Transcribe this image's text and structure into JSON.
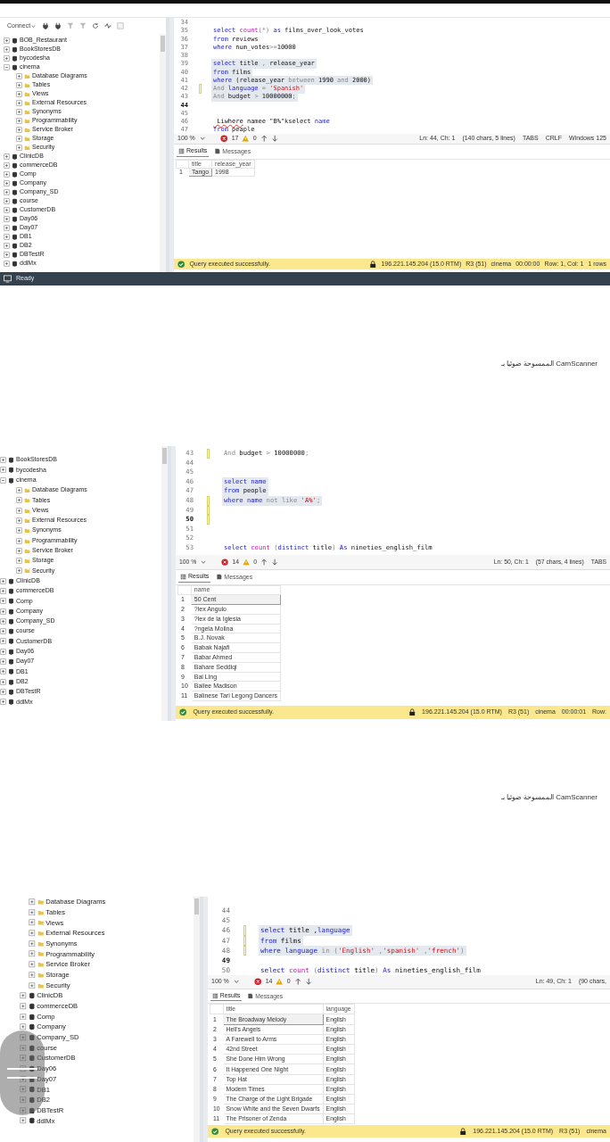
{
  "pages": [
    {
      "explorer": {
        "toolbar": {
          "connect_label": "Connect"
        },
        "items": [
          {
            "label": "BOB_Restaurant",
            "kind": "database",
            "expanded": false
          },
          {
            "label": "BookStoresDB",
            "kind": "database",
            "expanded": false
          },
          {
            "label": "bycodesha",
            "kind": "database",
            "expanded": false
          },
          {
            "label": "cinema",
            "kind": "database",
            "expanded": true,
            "children": [
              {
                "label": "Database Diagrams",
                "kind": "folder",
                "expanded": false
              },
              {
                "label": "Tables",
                "kind": "folder",
                "expanded": false
              },
              {
                "label": "Views",
                "kind": "folder",
                "expanded": false
              },
              {
                "label": "External Resources",
                "kind": "folder",
                "expanded": false
              },
              {
                "label": "Synonyms",
                "kind": "folder",
                "expanded": false
              },
              {
                "label": "Programmability",
                "kind": "folder",
                "expanded": false
              },
              {
                "label": "Service Broker",
                "kind": "folder",
                "expanded": false
              },
              {
                "label": "Storage",
                "kind": "folder",
                "expanded": false
              },
              {
                "label": "Security",
                "kind": "folder",
                "expanded": false
              }
            ]
          },
          {
            "label": "ClinicDB",
            "kind": "database",
            "expanded": false
          },
          {
            "label": "commerceDB",
            "kind": "database",
            "expanded": false
          },
          {
            "label": "Comp",
            "kind": "database",
            "expanded": false
          },
          {
            "label": "Company",
            "kind": "database",
            "expanded": false
          },
          {
            "label": "Company_SD",
            "kind": "database",
            "expanded": false
          },
          {
            "label": "course",
            "kind": "database",
            "expanded": false
          },
          {
            "label": "CustomerDB",
            "kind": "database",
            "expanded": false
          },
          {
            "label": "Day06",
            "kind": "database",
            "expanded": false
          },
          {
            "label": "Day07",
            "kind": "database",
            "expanded": false
          },
          {
            "label": "DB1",
            "kind": "database",
            "expanded": false
          },
          {
            "label": "DB2",
            "kind": "database",
            "expanded": false
          },
          {
            "label": "DBTestR",
            "kind": "database",
            "expanded": false
          },
          {
            "label": "ddlMx",
            "kind": "database",
            "expanded": false
          }
        ]
      },
      "editor": {
        "lines": [
          {
            "number": "34",
            "modified": false,
            "highlighted": false,
            "current": false
          },
          {
            "number": "35",
            "modified": false,
            "highlighted": false,
            "current": false,
            "tokens": [
              {
                "text": "select ",
                "kind": "keyword"
              },
              {
                "text": "count",
                "kind": "function"
              },
              {
                "text": "(*) ",
                "kind": "operator"
              },
              {
                "text": "as",
                "kind": "keyword"
              },
              {
                "text": " films_over_look_votes",
                "kind": "plain"
              }
            ]
          },
          {
            "number": "36",
            "modified": false,
            "highlighted": false,
            "current": false,
            "tokens": [
              {
                "text": "from",
                "kind": "keyword"
              },
              {
                "text": " reviews",
                "kind": "plain"
              }
            ]
          },
          {
            "number": "37",
            "modified": false,
            "highlighted": false,
            "current": false,
            "tokens": [
              {
                "text": "where",
                "kind": "keyword"
              },
              {
                "text": " num_votes",
                "kind": "plain"
              },
              {
                "text": ">=",
                "kind": "operator"
              },
              {
                "text": "10000",
                "kind": "plain"
              }
            ]
          },
          {
            "number": "38",
            "modified": false,
            "highlighted": false,
            "current": false
          },
          {
            "number": "39",
            "modified": false,
            "highlighted": true,
            "current": false,
            "tokens": [
              {
                "text": "select",
                "kind": "keyword"
              },
              {
                "text": " title ",
                "kind": "plain"
              },
              {
                "text": ",",
                "kind": "operator"
              },
              {
                "text": " release_year",
                "kind": "plain"
              }
            ]
          },
          {
            "number": "40",
            "modified": false,
            "highlighted": true,
            "current": false,
            "tokens": [
              {
                "text": "from",
                "kind": "keyword"
              },
              {
                "text": " films",
                "kind": "plain"
              }
            ]
          },
          {
            "number": "41",
            "modified": false,
            "highlighted": true,
            "current": false,
            "tokens": [
              {
                "text": "where",
                "kind": "keyword"
              },
              {
                "text": " (release_year ",
                "kind": "plain"
              },
              {
                "text": "between",
                "kind": "operator"
              },
              {
                "text": " 1990 ",
                "kind": "plain"
              },
              {
                "text": "and",
                "kind": "operator"
              },
              {
                "text": " 2000)",
                "kind": "plain"
              }
            ]
          },
          {
            "number": "42",
            "modified": true,
            "highlighted": true,
            "current": false,
            "tokens": [
              {
                "text": "And ",
                "kind": "operator"
              },
              {
                "text": "language",
                "kind": "keyword"
              },
              {
                "text": " = ",
                "kind": "operator"
              },
              {
                "text": "'Spanish'",
                "kind": "string"
              }
            ]
          },
          {
            "number": "43",
            "modified": false,
            "highlighted": true,
            "current": false,
            "tokens": [
              {
                "text": "And",
                "kind": "operator"
              },
              {
                "text": " budget ",
                "kind": "plain"
              },
              {
                "text": ">",
                "kind": "operator"
              },
              {
                "text": " 10000000",
                "kind": "plain"
              },
              {
                "text": ";",
                "kind": "operator"
              }
            ]
          },
          {
            "number": "44",
            "modified": false,
            "highlighted": false,
            "current": true
          },
          {
            "number": "45",
            "modified": false,
            "highlighted": false,
            "current": false
          },
          {
            "number": "46",
            "modified": false,
            "highlighted": false,
            "current": false,
            "tokens": [
              {
                "text": " Liwhere",
                "kind": "error"
              },
              {
                "text": " namee \"B%\"kselect ",
                "kind": "plain"
              },
              {
                "text": "name",
                "kind": "keyword"
              }
            ]
          },
          {
            "number": "47",
            "modified": false,
            "highlighted": false,
            "current": false,
            "tokens": [
              {
                "text": "from",
                "kind": "keyword"
              },
              {
                "text": " peaple",
                "kind": "plain"
              }
            ]
          }
        ],
        "toolbar": {
          "zoom": "100 %",
          "errors": "17",
          "warnings": "0",
          "info": [
            "Ln: 44, Ch: 1",
            "(140 chars, 5 lines)",
            "TABS",
            "CRLF",
            "Windows 125"
          ]
        }
      },
      "results": {
        "tabs": [
          {
            "label": "Results",
            "selected": true
          },
          {
            "label": "Messages",
            "selected": false
          }
        ],
        "columns": [
          "title",
          "release_year"
        ],
        "rows": [
          {
            "number": "1",
            "selected": true,
            "cells": [
              "Tango",
              "1998"
            ]
          }
        ]
      },
      "status_bar": {
        "message": "Query executed successfully.",
        "fields": [
          "196.221.145.204 (15.0 RTM)",
          "R3 (51)",
          "cinema",
          "00:00:00",
          "Row: 1, Col: 1",
          "1 rows"
        ]
      },
      "taskbar": {
        "status": "Ready"
      },
      "footer": "الممسوحة ضوئيا بـ CamScanner"
    },
    {
      "explorer": {
        "items": [
          {
            "label": "BookStoresDB",
            "kind": "database",
            "expanded": false
          },
          {
            "label": "bycodesha",
            "kind": "database",
            "expanded": false
          },
          {
            "label": "cinema",
            "kind": "database",
            "expanded": true,
            "children": [
              {
                "label": "Database Diagrams",
                "kind": "folder",
                "expanded": false
              },
              {
                "label": "Tables",
                "kind": "folder",
                "expanded": false
              },
              {
                "label": "Views",
                "kind": "folder",
                "expanded": false
              },
              {
                "label": "External Resources",
                "kind": "folder",
                "expanded": false
              },
              {
                "label": "Synonyms",
                "kind": "folder",
                "expanded": false
              },
              {
                "label": "Programmability",
                "kind": "folder",
                "expanded": false
              },
              {
                "label": "Service Broker",
                "kind": "folder",
                "expanded": false
              },
              {
                "label": "Storage",
                "kind": "folder",
                "expanded": false
              },
              {
                "label": "Security",
                "kind": "folder",
                "expanded": false
              }
            ]
          },
          {
            "label": "ClinicDB",
            "kind": "database",
            "expanded": false
          },
          {
            "label": "commerceDB",
            "kind": "database",
            "expanded": false
          },
          {
            "label": "Comp",
            "kind": "database",
            "expanded": false
          },
          {
            "label": "Company",
            "kind": "database",
            "expanded": false
          },
          {
            "label": "Company_SD",
            "kind": "database",
            "expanded": false
          },
          {
            "label": "course",
            "kind": "database",
            "expanded": false
          },
          {
            "label": "CustomerDB",
            "kind": "database",
            "expanded": false
          },
          {
            "label": "Day06",
            "kind": "database",
            "expanded": false
          },
          {
            "label": "Day07",
            "kind": "database",
            "expanded": false
          },
          {
            "label": "DB1",
            "kind": "database",
            "expanded": false
          },
          {
            "label": "DB2",
            "kind": "database",
            "expanded": false
          },
          {
            "label": "DBTestR",
            "kind": "database",
            "expanded": false
          },
          {
            "label": "ddlMx",
            "kind": "database",
            "expanded": false
          }
        ]
      },
      "editor": {
        "lines": [
          {
            "number": "43",
            "modified": true,
            "highlighted": false,
            "current": false,
            "tokens": [
              {
                "text": "And",
                "kind": "operator"
              },
              {
                "text": " budget ",
                "kind": "plain"
              },
              {
                "text": ">",
                "kind": "operator"
              },
              {
                "text": " 10000000",
                "kind": "plain"
              },
              {
                "text": ";",
                "kind": "operator"
              }
            ]
          },
          {
            "number": "44",
            "modified": false,
            "highlighted": false,
            "current": false
          },
          {
            "number": "45",
            "modified": false,
            "highlighted": false,
            "current": false
          },
          {
            "number": "46",
            "modified": false,
            "highlighted": true,
            "current": false,
            "tokens": [
              {
                "text": "select name",
                "kind": "keyword"
              }
            ]
          },
          {
            "number": "47",
            "modified": false,
            "highlighted": true,
            "current": false,
            "tokens": [
              {
                "text": "from",
                "kind": "keyword"
              },
              {
                "text": " people",
                "kind": "plain"
              }
            ]
          },
          {
            "number": "48",
            "modified": true,
            "highlighted": true,
            "current": false,
            "tokens": [
              {
                "text": "where name",
                "kind": "keyword"
              },
              {
                "text": " not like ",
                "kind": "operator"
              },
              {
                "text": "'A%'",
                "kind": "string"
              },
              {
                "text": ";",
                "kind": "operator"
              }
            ]
          },
          {
            "number": "49",
            "modified": true,
            "highlighted": false,
            "current": false
          },
          {
            "number": "50",
            "modified": true,
            "highlighted": false,
            "current": true
          },
          {
            "number": "51",
            "modified": false,
            "highlighted": false,
            "current": false
          },
          {
            "number": "52",
            "modified": false,
            "highlighted": false,
            "current": false
          },
          {
            "number": "53",
            "modified": false,
            "highlighted": false,
            "current": false,
            "tokens": [
              {
                "text": "select ",
                "kind": "keyword"
              },
              {
                "text": "count",
                "kind": "function"
              },
              {
                "text": " (",
                "kind": "operator"
              },
              {
                "text": "distinct",
                "kind": "keyword"
              },
              {
                "text": " title",
                "kind": "plain"
              },
              {
                "text": ") ",
                "kind": "operator"
              },
              {
                "text": "As",
                "kind": "keyword"
              },
              {
                "text": " nineties_english_film",
                "kind": "plain"
              }
            ]
          }
        ],
        "toolbar": {
          "zoom": "100 %",
          "errors": "14",
          "warnings": "0",
          "info": [
            "Ln: 50, Ch: 1",
            "(57 chars, 4 lines)",
            "TABS"
          ]
        }
      },
      "results": {
        "tabs": [
          {
            "label": "Results",
            "selected": true
          },
          {
            "label": "Messages",
            "selected": false
          }
        ],
        "columns": [
          "name"
        ],
        "rows": [
          {
            "number": "1",
            "selected": true,
            "cells": [
              "50 Cent"
            ]
          },
          {
            "number": "2",
            "selected": false,
            "cells": [
              "?lex Angulo"
            ]
          },
          {
            "number": "3",
            "selected": false,
            "cells": [
              "?lex de la Iglesia"
            ]
          },
          {
            "number": "4",
            "selected": false,
            "cells": [
              "?ngela Molina"
            ]
          },
          {
            "number": "5",
            "selected": false,
            "cells": [
              "B.J. Novak"
            ]
          },
          {
            "number": "6",
            "selected": false,
            "cells": [
              "Babak Najafi"
            ]
          },
          {
            "number": "7",
            "selected": false,
            "cells": [
              "Babar Ahmed"
            ]
          },
          {
            "number": "8",
            "selected": false,
            "cells": [
              "Bahare Seddiqi"
            ]
          },
          {
            "number": "9",
            "selected": false,
            "cells": [
              "Bai Ling"
            ]
          },
          {
            "number": "10",
            "selected": false,
            "cells": [
              "Bailee Madison"
            ]
          },
          {
            "number": "11",
            "selected": false,
            "cells": [
              "Balinese Tari Legong Dancers"
            ]
          }
        ]
      },
      "status_bar": {
        "message": "Query executed successfully.",
        "fields": [
          "196.221.145.204 (15.0 RTM)",
          "R3 (51)",
          "cinema",
          "00:00:01",
          "Row:"
        ]
      },
      "footer": "الممسوحة ضوئيا بـ CamScanner"
    },
    {
      "explorer": {
        "items": [
          {
            "label": "Database Diagrams",
            "kind": "folder",
            "expanded": false
          },
          {
            "label": "Tables",
            "kind": "folder",
            "expanded": false
          },
          {
            "label": "Views",
            "kind": "folder",
            "expanded": false
          },
          {
            "label": "External Resources",
            "kind": "folder",
            "expanded": false
          },
          {
            "label": "Synonyms",
            "kind": "folder",
            "expanded": false
          },
          {
            "label": "Programmability",
            "kind": "folder",
            "expanded": false
          },
          {
            "label": "Service Broker",
            "kind": "folder",
            "expanded": false
          },
          {
            "label": "Storage",
            "kind": "folder",
            "expanded": false
          },
          {
            "label": "Security",
            "kind": "folder",
            "expanded": false
          },
          {
            "label": "ClinicDB",
            "kind": "database",
            "expanded": false
          },
          {
            "label": "commerceDB",
            "kind": "database",
            "expanded": false
          },
          {
            "label": "Comp",
            "kind": "database",
            "expanded": false
          },
          {
            "label": "Company",
            "kind": "database",
            "expanded": false
          },
          {
            "label": "Company_SD",
            "kind": "database",
            "expanded": false
          },
          {
            "label": "course",
            "kind": "database",
            "expanded": false
          },
          {
            "label": "CustomerDB",
            "kind": "database",
            "expanded": false
          },
          {
            "label": "Day06",
            "kind": "database",
            "expanded": false
          },
          {
            "label": "Day07",
            "kind": "database",
            "expanded": false
          },
          {
            "label": "DB1",
            "kind": "database",
            "expanded": false
          },
          {
            "label": "DB2",
            "kind": "database",
            "expanded": false
          },
          {
            "label": "DBTestR",
            "kind": "database",
            "expanded": false
          },
          {
            "label": "ddlMx",
            "kind": "database",
            "expanded": false
          }
        ]
      },
      "editor": {
        "lines": [
          {
            "number": "44",
            "modified": false,
            "highlighted": false,
            "current": false
          },
          {
            "number": "45",
            "modified": false,
            "highlighted": false,
            "current": false
          },
          {
            "number": "46",
            "modified": true,
            "highlighted": true,
            "current": false,
            "tokens": [
              {
                "text": "select",
                "kind": "keyword"
              },
              {
                "text": " title ,",
                "kind": "plain"
              },
              {
                "text": "language",
                "kind": "keyword"
              }
            ]
          },
          {
            "number": "47",
            "modified": true,
            "highlighted": true,
            "current": false,
            "tokens": [
              {
                "text": "from",
                "kind": "keyword"
              },
              {
                "text": " films",
                "kind": "plain"
              }
            ]
          },
          {
            "number": "48",
            "modified": true,
            "highlighted": true,
            "current": false,
            "tokens": [
              {
                "text": "where language",
                "kind": "keyword"
              },
              {
                "text": " in (",
                "kind": "operator"
              },
              {
                "text": "'English'",
                "kind": "string"
              },
              {
                "text": " ,",
                "kind": "operator"
              },
              {
                "text": "'spanish'",
                "kind": "string"
              },
              {
                "text": " ,",
                "kind": "operator"
              },
              {
                "text": "'french'",
                "kind": "string"
              },
              {
                "text": ")",
                "kind": "operator"
              }
            ]
          },
          {
            "number": "49",
            "modified": false,
            "highlighted": false,
            "current": true
          },
          {
            "number": "50",
            "modified": false,
            "highlighted": false,
            "current": false,
            "tokens": [
              {
                "text": "select ",
                "kind": "keyword"
              },
              {
                "text": "count",
                "kind": "function"
              },
              {
                "text": " (",
                "kind": "operator"
              },
              {
                "text": "distinct",
                "kind": "keyword"
              },
              {
                "text": " title",
                "kind": "plain"
              },
              {
                "text": ") ",
                "kind": "operator"
              },
              {
                "text": "As",
                "kind": "keyword"
              },
              {
                "text": " nineties_english_film",
                "kind": "plain"
              }
            ]
          }
        ],
        "toolbar": {
          "zoom": "100 %",
          "errors": "14",
          "warnings": "0",
          "info": [
            "Ln: 49, Ch: 1",
            "(90 chars,"
          ]
        }
      },
      "results": {
        "tabs": [
          {
            "label": "Results",
            "selected": true
          },
          {
            "label": "Messages",
            "selected": false
          }
        ],
        "columns": [
          "title",
          "language"
        ],
        "rows": [
          {
            "number": "1",
            "selected": true,
            "cells": [
              "The Broadway Melody",
              "English"
            ]
          },
          {
            "number": "2",
            "selected": false,
            "cells": [
              "Hell's Angels",
              "English"
            ]
          },
          {
            "number": "3",
            "selected": false,
            "cells": [
              "A Farewell to Arms",
              "English"
            ]
          },
          {
            "number": "4",
            "selected": false,
            "cells": [
              "42nd Street",
              "English"
            ]
          },
          {
            "number": "5",
            "selected": false,
            "cells": [
              "She Done Him Wrong",
              "English"
            ]
          },
          {
            "number": "6",
            "selected": false,
            "cells": [
              "It Happened One Night",
              "English"
            ]
          },
          {
            "number": "7",
            "selected": false,
            "cells": [
              "Top Hat",
              "English"
            ]
          },
          {
            "number": "8",
            "selected": false,
            "cells": [
              "Modern Times",
              "English"
            ]
          },
          {
            "number": "9",
            "selected": false,
            "cells": [
              "The Charge of the Light Brigade",
              "English"
            ]
          },
          {
            "number": "10",
            "selected": false,
            "cells": [
              "Snow White and the Seven Dwarfs",
              "English"
            ]
          },
          {
            "number": "11",
            "selected": false,
            "cells": [
              "The Prisoner of Zenda",
              "English"
            ]
          }
        ]
      },
      "status_bar": {
        "message": "Query executed successfully.",
        "fields": [
          "196.221.145.204 (15.0 RTM)",
          "R3 (51)",
          "cinema"
        ]
      }
    }
  ]
}
